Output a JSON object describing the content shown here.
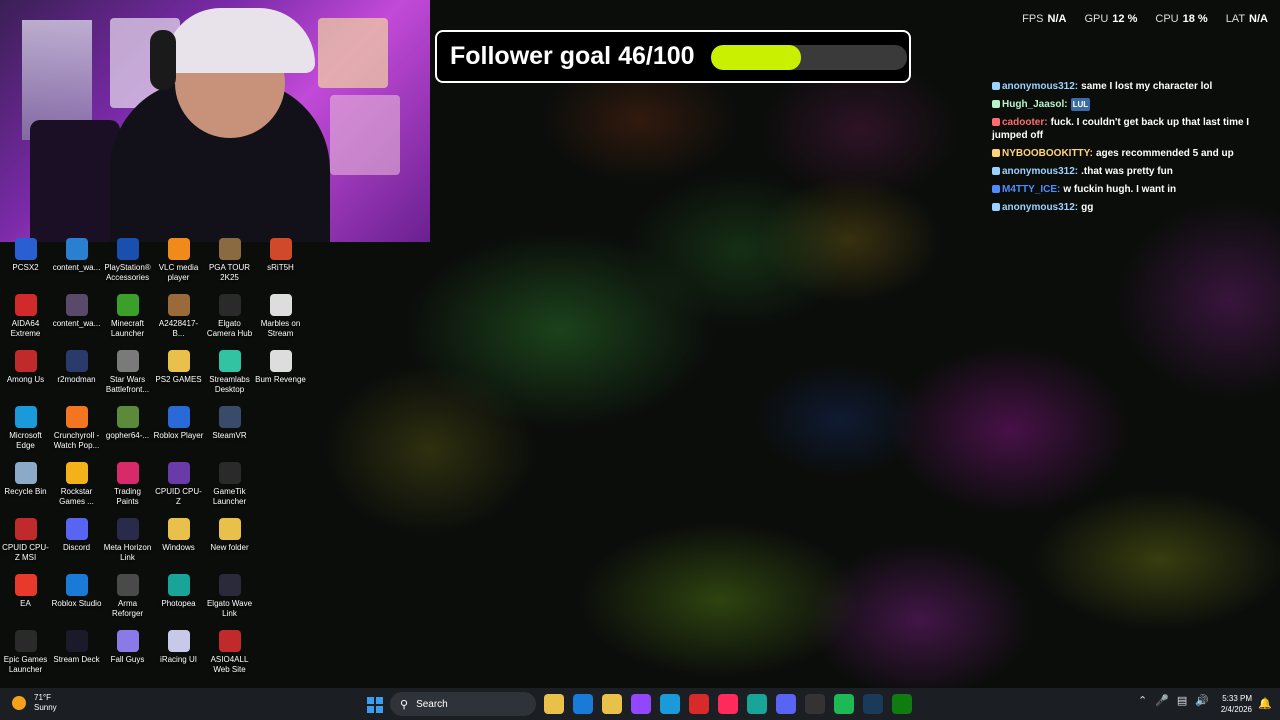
{
  "goal": {
    "label": "Follower goal 46/100",
    "progress": 0.46
  },
  "stats": [
    {
      "label": "FPS",
      "value": "N/A"
    },
    {
      "label": "GPU",
      "value": "12 %"
    },
    {
      "label": "CPU",
      "value": "18 %"
    },
    {
      "label": "LAT",
      "value": "N/A"
    }
  ],
  "chat": [
    {
      "name": "anonymous312:",
      "text": "same I lost my character lol",
      "color": "#9ad3ff"
    },
    {
      "name": "Hugh_Jaasol:",
      "text": "",
      "emote": "LUL",
      "color": "#b9f3c8"
    },
    {
      "name": "cadooter:",
      "text": "fuck. I couldn't get back up that last time I jumped off",
      "color": "#ff6e6e"
    },
    {
      "name": "NYBOOBOOKITTY:",
      "text": "ages recommended 5 and up",
      "color": "#ffd37a"
    },
    {
      "name": "anonymous312:",
      "text": ".that was pretty fun",
      "color": "#9ad3ff"
    },
    {
      "name": "M4TTY_ICE:",
      "text": "w fuckin hugh. I want in",
      "color": "#4f8dff"
    },
    {
      "name": "anonymous312:",
      "text": "gg",
      "color": "#9ad3ff"
    }
  ],
  "icons": [
    {
      "label": "PCSX2",
      "color": "#2a5fd1"
    },
    {
      "label": "content_wa...",
      "color": "#2a7fd1"
    },
    {
      "label": "PlayStation® Accessories",
      "color": "#1a4fb0"
    },
    {
      "label": "VLC media player",
      "color": "#f08a1a"
    },
    {
      "label": "PGA TOUR 2K25",
      "color": "#8a6a40"
    },
    {
      "label": "sRiT5H",
      "color": "#d04a2a"
    },
    {
      "label": "AIDA64 Extreme",
      "color": "#d12a2a"
    },
    {
      "label": "content_wa...",
      "color": "#5a4a6a"
    },
    {
      "label": "Minecraft Launcher",
      "color": "#3aa02a"
    },
    {
      "label": "A2428417-B...",
      "color": "#9a6a3a"
    },
    {
      "label": "Elgato Camera Hub",
      "color": "#2a2a2a"
    },
    {
      "label": "Marbles on Stream",
      "color": "#dddddd"
    },
    {
      "label": "Among Us",
      "color": "#c12a2a"
    },
    {
      "label": "r2modman",
      "color": "#2a3a6a"
    },
    {
      "label": "Star Wars Battlefront...",
      "color": "#7a7a7a"
    },
    {
      "label": "PS2 GAMES",
      "color": "#e8c04a"
    },
    {
      "label": "Streamlabs Desktop",
      "color": "#31c3a2"
    },
    {
      "label": "Bum Revenge",
      "color": "#dddddd"
    },
    {
      "label": "Microsoft Edge",
      "color": "#1a9ad8"
    },
    {
      "label": "Crunchyroll - Watch Pop...",
      "color": "#f47521"
    },
    {
      "label": "gopher64-...",
      "color": "#5a8a3a"
    },
    {
      "label": "Roblox Player",
      "color": "#2a6ad8"
    },
    {
      "label": "SteamVR",
      "color": "#3a4a6a"
    },
    {
      "label": "",
      "color": "transparent"
    },
    {
      "label": "Recycle Bin",
      "color": "#8aaac8"
    },
    {
      "label": "Rockstar Games ...",
      "color": "#f4b21a"
    },
    {
      "label": "Trading Paints",
      "color": "#d82a6a"
    },
    {
      "label": "CPUID CPU-Z",
      "color": "#6a3aa8"
    },
    {
      "label": "GameTik Launcher",
      "color": "#2a2a2a"
    },
    {
      "label": "",
      "color": "transparent"
    },
    {
      "label": "CPUID CPU-Z MSI",
      "color": "#c12a2a"
    },
    {
      "label": "Discord",
      "color": "#5865f2"
    },
    {
      "label": "Meta Horizon Link",
      "color": "#2a2a4a"
    },
    {
      "label": "Windows",
      "color": "#e8c04a"
    },
    {
      "label": "New folder",
      "color": "#e8c04a"
    },
    {
      "label": "",
      "color": "transparent"
    },
    {
      "label": "EA",
      "color": "#e83a2a"
    },
    {
      "label": "Roblox Studio",
      "color": "#1a7ad8"
    },
    {
      "label": "Arma Reforger",
      "color": "#4a4a4a"
    },
    {
      "label": "Photopea",
      "color": "#18a497"
    },
    {
      "label": "Elgato Wave Link",
      "color": "#2a2a3a"
    },
    {
      "label": "",
      "color": "transparent"
    },
    {
      "label": "Epic Games Launcher",
      "color": "#2a2a2a"
    },
    {
      "label": "Stream Deck",
      "color": "#1a1a2a"
    },
    {
      "label": "Fall Guys",
      "color": "#8a7ae8"
    },
    {
      "label": "iRacing UI",
      "color": "#c8c8e8"
    },
    {
      "label": "ASIO4ALL Web Site",
      "color": "#c12a2a"
    }
  ],
  "taskbar": {
    "temp": "71°F",
    "condition": "Sunny",
    "search_placeholder": "Search",
    "time": "5:33 PM",
    "date": "2/4/2026",
    "apps": [
      {
        "name": "file-explorer",
        "color": "#e8c04a"
      },
      {
        "name": "microsoft-store",
        "color": "#1a7ad8"
      },
      {
        "name": "folder",
        "color": "#e8c04a"
      },
      {
        "name": "twitch",
        "color": "#9146ff"
      },
      {
        "name": "edge",
        "color": "#1a9ad8"
      },
      {
        "name": "tf",
        "color": "#d82a2a"
      },
      {
        "name": "tiktok",
        "color": "#ff2a5a"
      },
      {
        "name": "photopea",
        "color": "#18a497"
      },
      {
        "name": "discord",
        "color": "#5865f2"
      },
      {
        "name": "obs",
        "color": "#333333"
      },
      {
        "name": "spotify",
        "color": "#1db954"
      },
      {
        "name": "steam",
        "color": "#1a3a5a"
      },
      {
        "name": "xbox",
        "color": "#107c10"
      }
    ]
  }
}
